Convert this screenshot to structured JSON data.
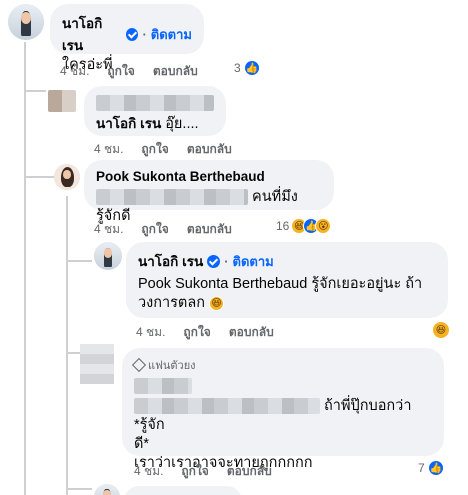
{
  "comment1": {
    "author": "นาโอกิ เรน",
    "separator": "·",
    "follow": "ติดตาม",
    "text": "ใครอ่ะพี่",
    "time": "4 ชม.",
    "like": "ถูกใจ",
    "reply": "ตอบกลับ",
    "reaction_count": "3"
  },
  "reply1": {
    "author": "นาโอกิ เรน",
    "text": "อุ๊ย...."
  },
  "reply1_meta": {
    "time": "4 ชม.",
    "like": "ถูกใจ",
    "reply": "ตอบกลับ"
  },
  "comment2": {
    "author": "Pook Sukonta Berthebaud",
    "text": "คนที่มึงรู้จักดี",
    "time": "4 ชม.",
    "like": "ถูกใจ",
    "reply": "ตอบกลับ",
    "reaction_count": "16"
  },
  "comment3": {
    "author": "นาโอกิ เรน",
    "separator": "·",
    "follow": "ติดตาม",
    "mention": "Pook Sukonta Berthebaud",
    "text": "รู้จักเยอะอยู่นะ ถ้าวงการตลก",
    "time": "4 ชม.",
    "like": "ถูกใจ",
    "reply": "ตอบกลับ"
  },
  "comment4": {
    "badge": "แฟนตัวยง",
    "text_line1": "ถ้าพี่ปุ๊กบอกว่า *รู้จัก",
    "text_line2": "ดี*",
    "text_line3": "เราว่าเราอาจจะทายถูกกกกก",
    "time": "4 ชม.",
    "like": "ถูกใจ",
    "reply": "ตอบกลับ",
    "reaction_count": "7"
  },
  "icons": {
    "like": "like-icon",
    "haha": "haha-icon",
    "wow": "wow-icon",
    "verified": "verified-icon",
    "top_fan": "diamond-icon"
  },
  "colors": {
    "link": "#0866ff",
    "meta": "#65676b",
    "bubble": "#f0f2f5"
  }
}
